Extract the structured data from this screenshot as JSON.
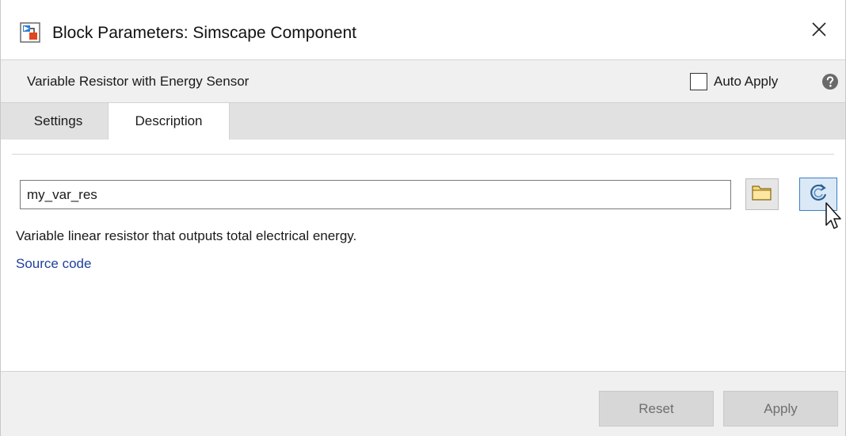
{
  "window": {
    "title": "Block Parameters: Simscape Component"
  },
  "header": {
    "block_name": "Variable Resistor with Energy Sensor",
    "auto_apply_label": "Auto Apply",
    "auto_apply_checked": false
  },
  "tabs": [
    {
      "label": "Settings",
      "active": false
    },
    {
      "label": "Description",
      "active": true
    }
  ],
  "description": {
    "component_name": "my_var_res",
    "text": "Variable linear resistor that outputs total electrical energy.",
    "source_link": "Source code"
  },
  "footer": {
    "reset_label": "Reset",
    "apply_label": "Apply"
  },
  "icons": {
    "app": "simulink-block-icon",
    "close": "close-icon",
    "help": "help-icon",
    "browse": "folder-icon",
    "refresh": "refresh-icon",
    "cursor": "mouse-pointer-icon"
  },
  "colors": {
    "link": "#1f3f9b",
    "refresh_border": "#3c7fc4",
    "refresh_fill": "#dbe9f7",
    "panel_bg": "#f0f0f0",
    "disabled_text": "#6e6e6e"
  }
}
